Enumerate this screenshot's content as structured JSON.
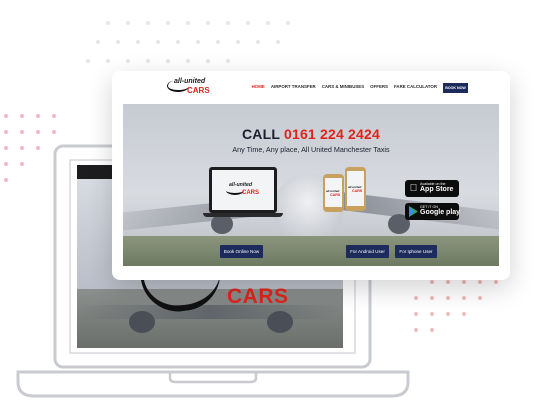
{
  "nav": {
    "logo_line1": "all-united",
    "logo_line2": "CARS",
    "menu": [
      "HOME",
      "AIRPORT TRANSFER",
      "CARS & MINIBUSES",
      "OFFERS",
      "FARE CALCULATOR"
    ],
    "book_label": "BOOK NOW"
  },
  "hero": {
    "call_prefix": "CALL",
    "call_number": "0161 224 2424",
    "tagline": "Any Time, Any place, All United Manchester Taxis",
    "device_logo_line1": "all-united",
    "device_logo_line2": "CARS",
    "app_store": {
      "line1": "Available on the",
      "line2": "App Store",
      "icon": "apple-icon"
    },
    "google_play": {
      "line1": "GET IT ON",
      "line2": "Google play",
      "icon": "play-icon"
    },
    "buttons": {
      "book_online": "Book Online Now",
      "android": "For Android User",
      "iphone": "For Iphone User"
    }
  },
  "background_laptop": {
    "brand_text": "CARS"
  },
  "colors": {
    "accent_red": "#e0241c",
    "navy": "#1c2a5c",
    "dot_pink": "#f2b9c0",
    "outline_gray": "#c9cbd1"
  }
}
